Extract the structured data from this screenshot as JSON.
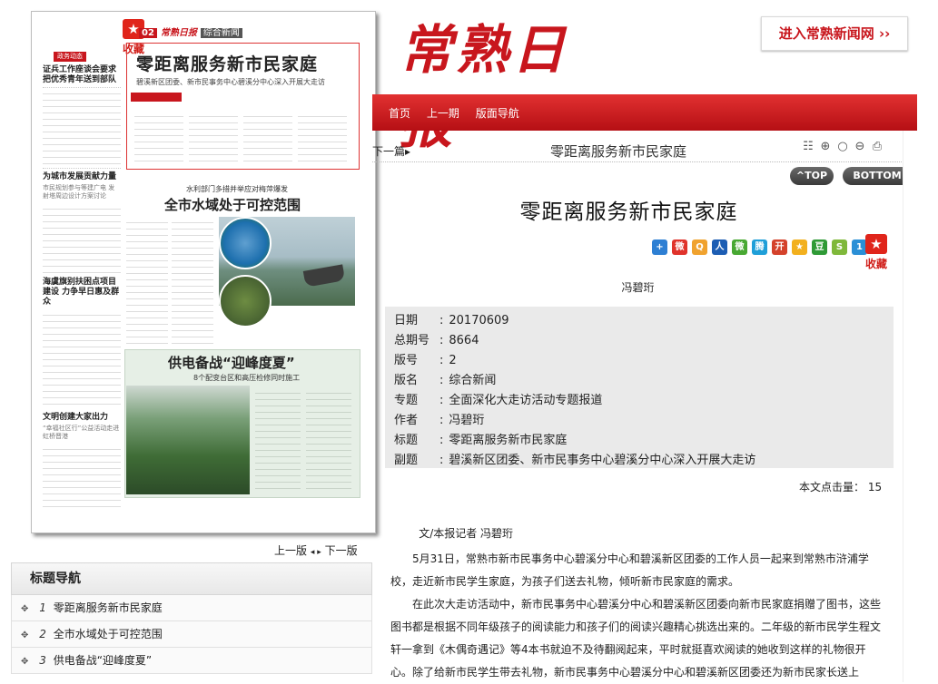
{
  "header": {
    "masthead": "常熟日报",
    "enter_site": "进入常熟新闻网",
    "enter_arrows": "››",
    "nav": [
      "首页",
      "上一期",
      "版面导航"
    ]
  },
  "paper_thumb": {
    "bookmark_star": "★",
    "bookmark": "收藏",
    "page_no": "02",
    "logo": "常熟日报",
    "section": "综合新闻",
    "left_tag": "政务动态",
    "left_head1": "证兵工作座谈会要求 把优秀青年送到部队",
    "left_head2": "为城市发展贡献力量",
    "left_sub2": "市民规划参与等建广电 发射塔周边设计方案讨论",
    "left_head3": "海虞旗别扶困点项目建设 力争早日惠及群众",
    "left_head4": "文明创建大家出力",
    "left_sub4": "“幸福社区行”公益活动走进虹桥晋港",
    "story1_title": "零距离服务新市民家庭",
    "story1_sub": "碧溪新区团委、新市民事务中心碧溪分中心深入开展大走访",
    "story2_kicker": "水利部门多措并举应对梅萍爆发",
    "story2_title": "全市水域处于可控范围",
    "story3_title": "供电备战“迎峰度夏”",
    "story3_sub": "8个配变台区和高压检修同时施工"
  },
  "page_nav": {
    "prev": "上一版",
    "arrows": "◂ ▸",
    "next": "下一版"
  },
  "title_nav": {
    "header": "标题导航",
    "items": [
      {
        "num": "1",
        "title": "零距离服务新市民家庭"
      },
      {
        "num": "2",
        "title": "全市水域处于可控范围"
      },
      {
        "num": "3",
        "title": "供电备战“迎峰度夏”"
      }
    ]
  },
  "article": {
    "next_page": "下一篇▸",
    "section_title": "零距离服务新市民家庭",
    "top": "^TOP",
    "bottom": "BOTTOM",
    "title": "零距离服务新市民家庭",
    "bookmark": "收藏",
    "author": "冯碧珩",
    "meta": [
      {
        "k": "日期",
        "v": "20170609"
      },
      {
        "k": "总期号",
        "v": "8664"
      },
      {
        "k": "版号",
        "v": "2"
      },
      {
        "k": "版名",
        "v": "综合新闻"
      },
      {
        "k": "专题",
        "v": "全面深化大走访活动专题报道"
      },
      {
        "k": "作者",
        "v": "冯碧珩"
      },
      {
        "k": "标题",
        "v": "零距离服务新市民家庭"
      },
      {
        "k": "副题",
        "v": "碧溪新区团委、新市民事务中心碧溪分中心深入开展大走访"
      }
    ],
    "clicks_label": "本文点击量：",
    "clicks": "15",
    "byline": "文/本报记者 冯碧珩",
    "p1": "5月31日，常熟市新市民事务中心碧溪分中心和碧溪新区团委的工作人员一起来到常熟市浒浦学校，走近新市民学生家庭，为孩子们送去礼物，倾听新市民家庭的需求。",
    "p2": "在此次大走访活动中，新市民事务中心碧溪分中心和碧溪新区团委向新市民家庭捐赠了图书，这些图书都是根据不同年级孩子的阅读能力和孩子们的阅读兴趣精心挑选出来的。二年级的新市民学生程文轩一拿到《木偶奇遇记》等4本书就迫不及待翻阅起来，平时就挺喜欢阅读的她收到这样的礼物很开心。除了给新市民学生带去礼物，新市民事务中心碧溪分中心和碧溪新区团委还为新市民家长送上"
  },
  "icons": {
    "toolbar": [
      "list-icon",
      "zoom-in-icon",
      "zoom-reset-icon",
      "zoom-out-icon",
      "print-icon"
    ],
    "share": [
      {
        "name": "share-more-icon",
        "glyph": "+",
        "color": "#2d7fd3"
      },
      {
        "name": "share-weibo-icon",
        "glyph": "微",
        "color": "#e0332b"
      },
      {
        "name": "share-qzone-icon",
        "glyph": "Q",
        "color": "#f0a22e"
      },
      {
        "name": "share-renren-icon",
        "glyph": "人",
        "color": "#1c5db3"
      },
      {
        "name": "share-wechat-icon",
        "glyph": "微",
        "color": "#48a832"
      },
      {
        "name": "share-tqq-icon",
        "glyph": "腾",
        "color": "#1f9fd8"
      },
      {
        "name": "share-kaixin-icon",
        "glyph": "开",
        "color": "#d4422b"
      },
      {
        "name": "share-favorite-icon",
        "glyph": "★",
        "color": "#f2b01e"
      },
      {
        "name": "share-douban-icon",
        "glyph": "豆",
        "color": "#2f9a36"
      },
      {
        "name": "share-sohu-icon",
        "glyph": "S",
        "color": "#7fb83a"
      },
      {
        "name": "share-yixin-icon",
        "glyph": "1",
        "color": "#2a8fd6"
      }
    ]
  }
}
